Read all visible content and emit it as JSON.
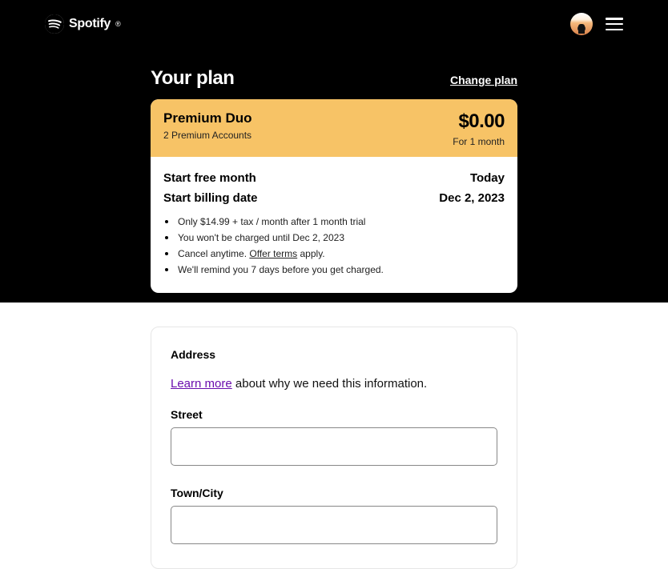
{
  "header": {
    "brand": "Spotify"
  },
  "plan": {
    "section_title": "Your plan",
    "change_link": "Change plan",
    "name": "Premium Duo",
    "subline": "2 Premium Accounts",
    "price": "$0.00",
    "price_term": "For 1 month",
    "rows": [
      {
        "label": "Start free month",
        "value": "Today"
      },
      {
        "label": "Start billing date",
        "value": "Dec 2, 2023"
      }
    ],
    "notes": {
      "n0": "Only $14.99 + tax / month after 1 month trial",
      "n1": "You won't be charged until Dec 2, 2023",
      "n2_pre": "Cancel anytime. ",
      "n2_link": "Offer terms",
      "n2_post": " apply.",
      "n3": "We'll remind you 7 days before you get charged."
    }
  },
  "form": {
    "address_title": "Address",
    "learn_more": "Learn more",
    "learn_more_rest": " about why we need this information.",
    "street_label": "Street",
    "street_value": "",
    "city_label": "Town/City",
    "city_value": ""
  }
}
